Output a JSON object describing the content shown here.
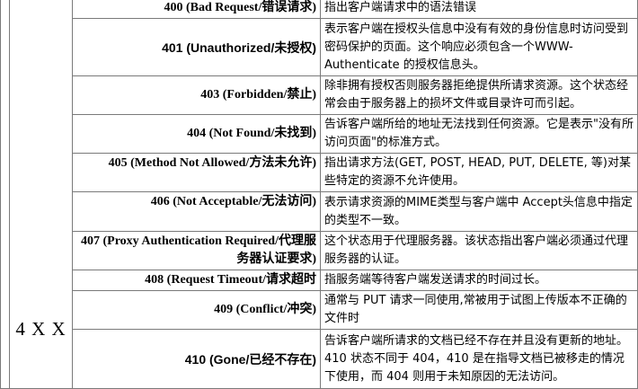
{
  "group_label": "4 X X",
  "rows": [
    {
      "code": "400 (Bad Request/错误请求)",
      "description": "指出客户端请求中的语法错误"
    },
    {
      "code": "401 (Unauthorized/未授权)",
      "description": "表示客户端在授权头信息中没有有效的身份信息时访问受到密码保护的页面。这个响应必须包含一个WWW-Authenticate 的授权信息头。"
    },
    {
      "code": "403 (Forbidden/禁止)",
      "description": "除非拥有授权否则服务器拒绝提供所请求资源。这个状态经常会由于服务器上的损坏文件或目录许可而引起。"
    },
    {
      "code": "404 (Not Found/未找到)",
      "description": "告诉客户端所给的地址无法找到任何资源。它是表示\"没有所访问页面\"的标准方式。"
    },
    {
      "code": "405 (Method Not Allowed/方法未允许)",
      "description": "指出请求方法(GET, POST, HEAD, PUT, DELETE, 等)对某些特定的资源不允许使用。"
    },
    {
      "code": "406 (Not Acceptable/无法访问)",
      "description": "表示请求资源的MIME类型与客户端中 Accept头信息中指定的类型不一致。"
    },
    {
      "code": "407 (Proxy Authentication Required/代理服务器认证要求)",
      "description": "这个状态用于代理服务器。该状态指出客户端必须通过代理服务器的认证。"
    },
    {
      "code": "408 (Request Timeout/请求超时",
      "description": "指服务端等待客户端发送请求的时间过长。"
    },
    {
      "code": "409 (Conflict/冲突)",
      "description": "通常与 PUT 请求一同使用,常被用于试图上传版本不正确的文件时"
    },
    {
      "code": "410 (Gone/已经不存在)",
      "description": "告诉客户端所请求的文档已经不存在并且没有更新的地址。410 状态不同于 404，410 是在指导文档已被移走的情况下使用，而 404 则用于未知原因的无法访问。"
    }
  ]
}
